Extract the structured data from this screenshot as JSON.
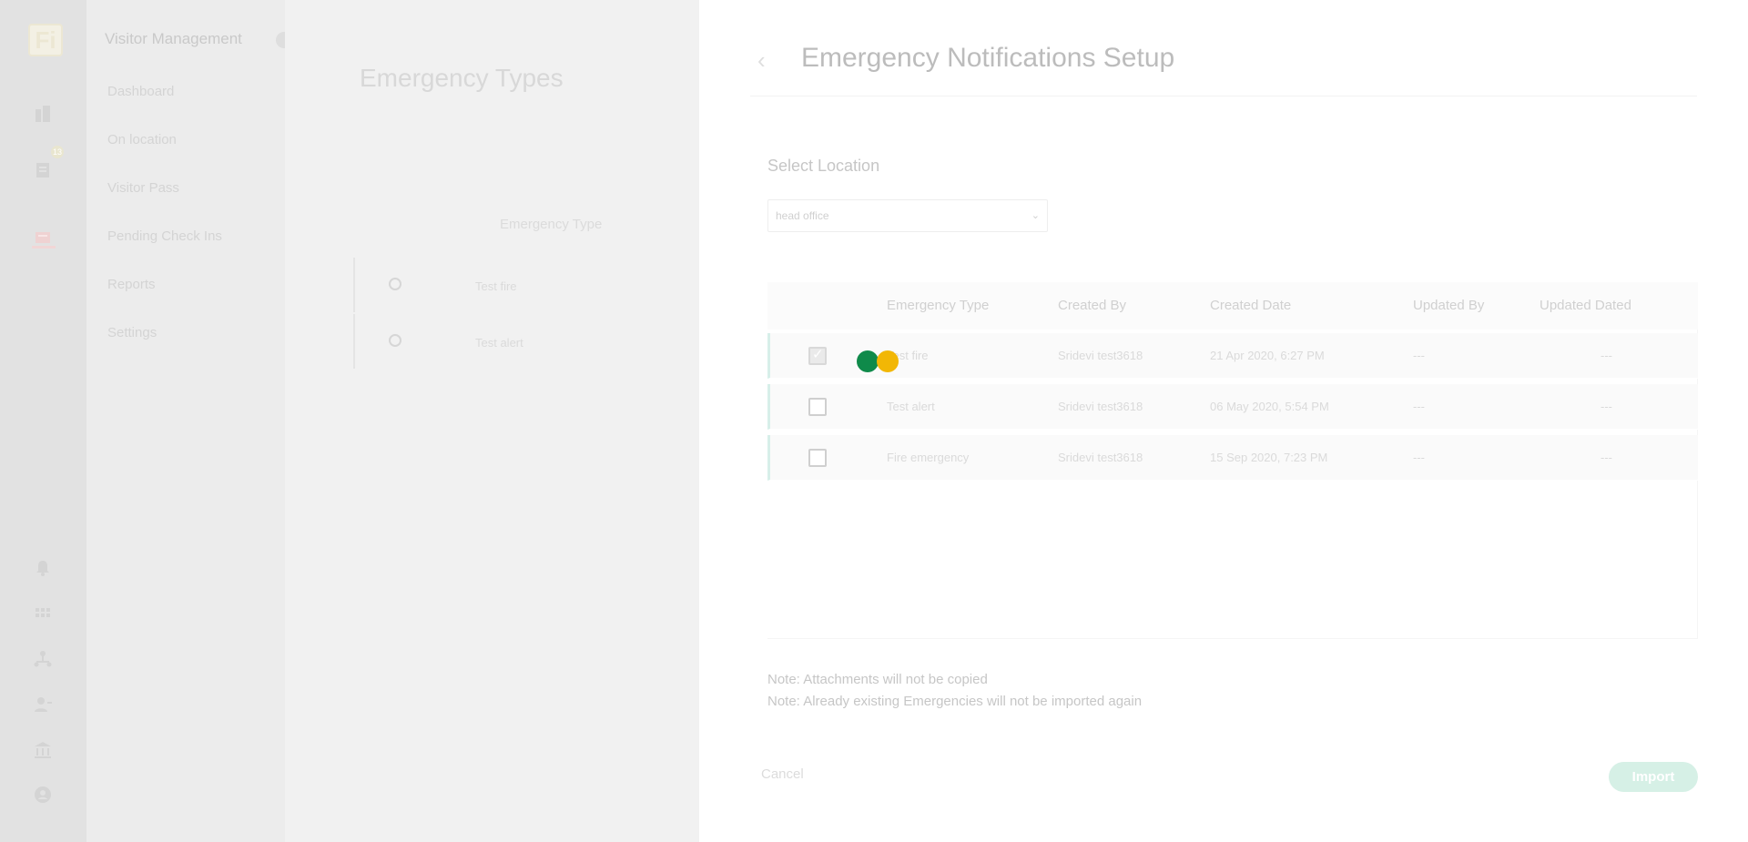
{
  "app": {
    "logo_text": "Fi",
    "notification_badge": "13"
  },
  "subnav": {
    "title": "Visitor Management",
    "items": [
      {
        "label": "Dashboard"
      },
      {
        "label": "On location"
      },
      {
        "label": "Visitor Pass"
      },
      {
        "label": "Pending Check Ins"
      },
      {
        "label": "Reports"
      },
      {
        "label": "Settings"
      }
    ]
  },
  "background_page": {
    "title": "Emergency Types",
    "column_header": "Emergency Type",
    "rows": [
      {
        "label": "Test fire"
      },
      {
        "label": "Test alert"
      }
    ]
  },
  "modal": {
    "title": "Emergency Notifications Setup",
    "select_location_label": "Select Location",
    "location_value": "head office",
    "columns": [
      "Emergency Type",
      "Created By",
      "Created Date",
      "Updated By",
      "Updated Dated"
    ],
    "rows": [
      {
        "checked": true,
        "type": "Test fire",
        "created_by": "Sridevi test3618",
        "created_date": "21 Apr 2020, 6:27 PM",
        "updated_by": "---",
        "updated_dated": "---"
      },
      {
        "checked": false,
        "type": "Test alert",
        "created_by": "Sridevi test3618",
        "created_date": "06 May 2020, 5:54 PM",
        "updated_by": "---",
        "updated_dated": "---"
      },
      {
        "checked": false,
        "type": "Fire emergency",
        "created_by": "Sridevi test3618",
        "created_date": "15 Sep 2020, 7:23 PM",
        "updated_by": "---",
        "updated_dated": "---"
      }
    ],
    "note_1": "Note: Attachments will not be copied",
    "note_2": "Note: Already existing Emergencies will not be imported again",
    "cancel_label": "Cancel",
    "import_label": "Import"
  },
  "colors": {
    "loader_green": "#0f8a4a",
    "loader_yellow": "#f2b705",
    "accent_teal": "#d6f0e6"
  }
}
